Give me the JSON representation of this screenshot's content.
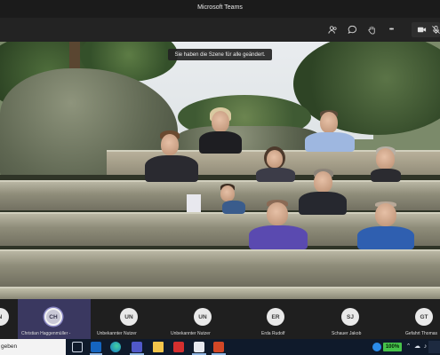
{
  "window": {
    "title": "Microsoft Teams"
  },
  "toolbar": {
    "icons": [
      "people-icon",
      "chat-icon",
      "raise-hand-icon",
      "more-icon",
      "camera-icon",
      "mic-off-icon"
    ],
    "more_label": "•••"
  },
  "stage": {
    "banner": "Sie haben die Szene für alle geändert."
  },
  "participants": [
    {
      "initials": "N",
      "name": ""
    },
    {
      "initials": "CH",
      "name": "Christian Haggenmüller -",
      "active": true
    },
    {
      "initials": "UN",
      "name": "Unbekannter Nutzer"
    },
    {
      "initials": "UN",
      "name": "Unbekannter Nutzer"
    },
    {
      "initials": "ER",
      "name": "Erda Rudolf"
    },
    {
      "initials": "SJ",
      "name": "Schauer Jakob"
    },
    {
      "initials": "GT",
      "name": "Gefahrt Thomas"
    }
  ],
  "taskbar": {
    "search_text": "geben",
    "battery": "100%",
    "app_icons": [
      "task-view-icon",
      "outlook-icon",
      "edge-icon",
      "teams-icon",
      "file-explorer-icon",
      "acrobat-icon",
      "app-icon",
      "powerpoint-icon"
    ]
  }
}
